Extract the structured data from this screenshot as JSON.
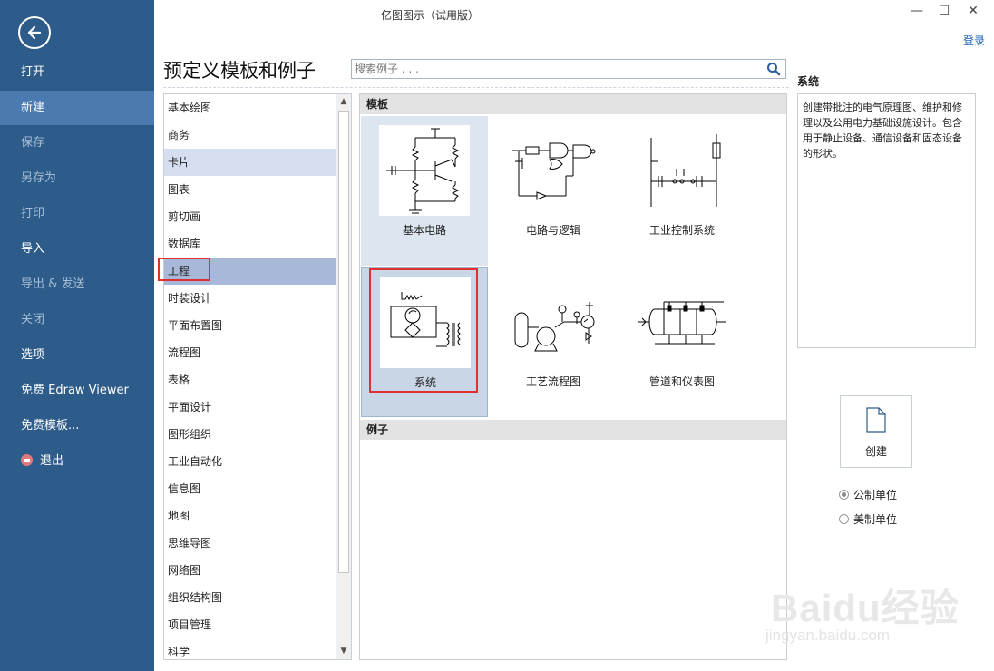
{
  "window": {
    "title": "亿图图示（试用版）",
    "minimize": "—",
    "maximize": "☐",
    "close": "✕",
    "login": "登录"
  },
  "sidebar": {
    "items": [
      {
        "label": "打开",
        "state": "normal"
      },
      {
        "label": "新建",
        "state": "active"
      },
      {
        "label": "保存",
        "state": "disabled"
      },
      {
        "label": "另存为",
        "state": "disabled"
      },
      {
        "label": "打印",
        "state": "disabled"
      },
      {
        "label": "导入",
        "state": "normal"
      },
      {
        "label": "导出 & 发送",
        "state": "disabled"
      },
      {
        "label": "关闭",
        "state": "disabled"
      },
      {
        "label": "选项",
        "state": "normal"
      },
      {
        "label": "免费 Edraw Viewer",
        "state": "normal"
      },
      {
        "label": "免费模板...",
        "state": "normal"
      },
      {
        "label": "退出",
        "state": "normal"
      }
    ]
  },
  "main": {
    "title": "预定义模板和例子",
    "search_placeholder": "搜索例子 . . ."
  },
  "categories": [
    "基本绘图",
    "商务",
    "卡片",
    "图表",
    "剪切画",
    "数据库",
    "工程",
    "时装设计",
    "平面布置图",
    "流程图",
    "表格",
    "平面设计",
    "图形组织",
    "工业自动化",
    "信息图",
    "地图",
    "思维导图",
    "网络图",
    "组织结构图",
    "项目管理",
    "科学"
  ],
  "templates": {
    "header": "模板",
    "items": [
      {
        "label": "基本电路",
        "icon": "basic-circuit-icon"
      },
      {
        "label": "电路与逻辑",
        "icon": "circuit-logic-icon"
      },
      {
        "label": "工业控制系统",
        "icon": "industrial-control-icon"
      },
      {
        "label": "系统",
        "icon": "system-icon"
      },
      {
        "label": "工艺流程图",
        "icon": "process-flow-icon"
      },
      {
        "label": "管道和仪表图",
        "icon": "pid-icon"
      }
    ]
  },
  "examples": {
    "header": "例子"
  },
  "description": {
    "title": "系统",
    "text": "创建带批注的电气原理图、维护和修理以及公用电力基础设施设计。包含用于静止设备、通信设备和固态设备的形状。"
  },
  "create": {
    "label": "创建"
  },
  "units": {
    "metric": "公制单位",
    "us": "美制单位",
    "selected": "metric"
  },
  "watermark": {
    "main": "Baidu经验",
    "sub": "jingyan.baidu.com"
  },
  "colors": {
    "sidebar": "#2e5c8a",
    "sidebar_active": "#4a7ab0",
    "category_selected": "#a8b8d8",
    "highlight_red": "#e03030",
    "link": "#1a5fb4"
  }
}
